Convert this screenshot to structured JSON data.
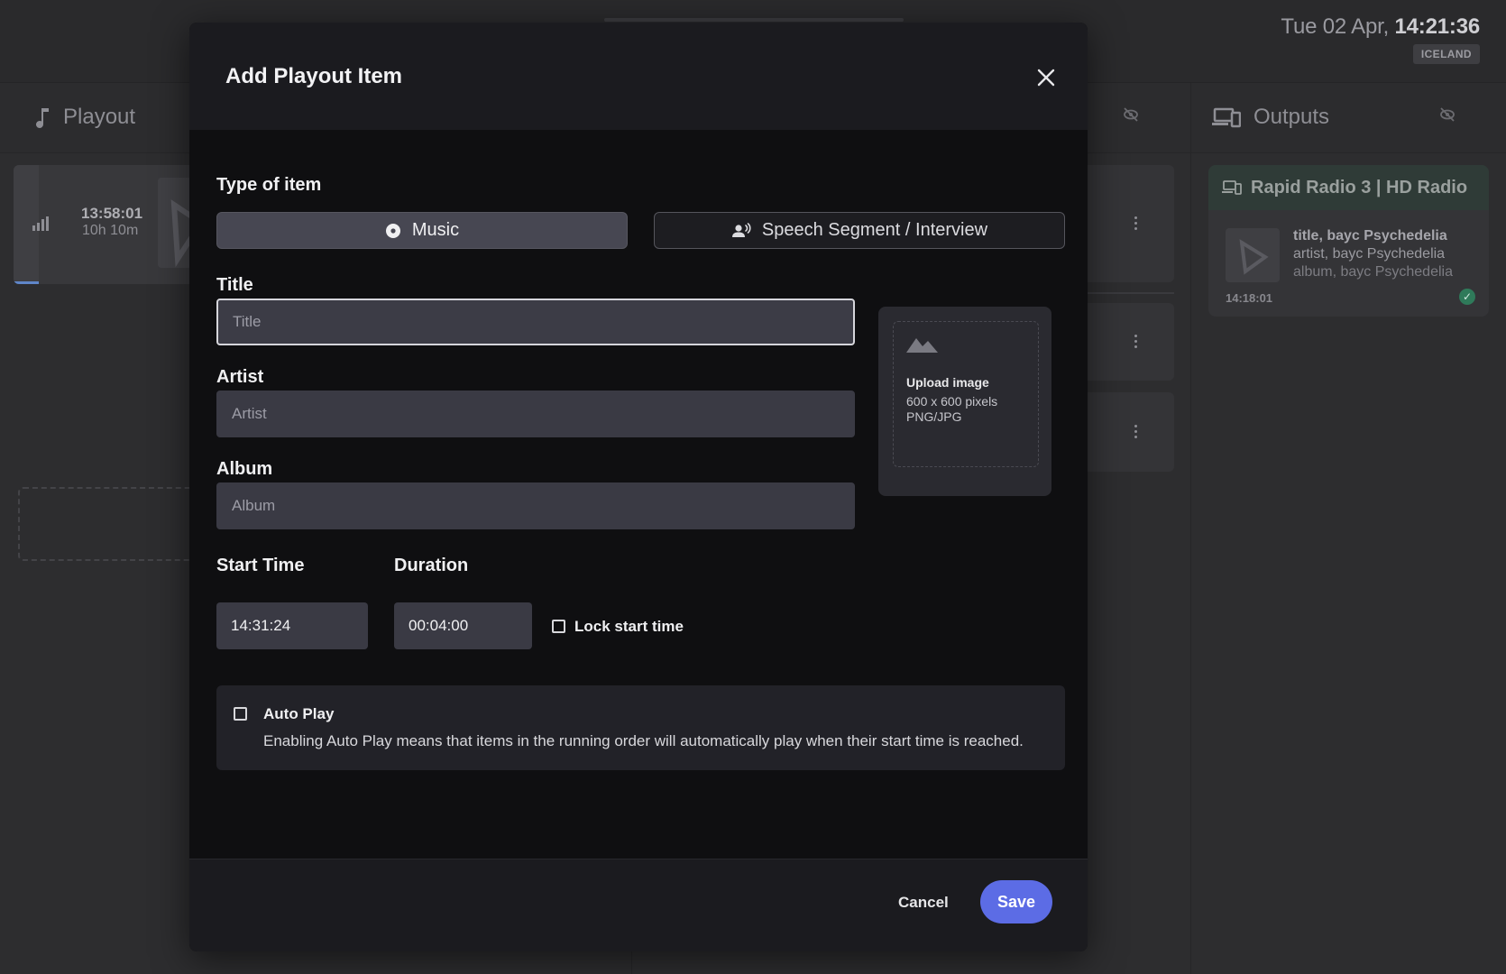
{
  "background": {
    "clock": {
      "date": "Tue 02 Apr,",
      "time": "14:21:36",
      "timezone": "ICELAND"
    },
    "panels": {
      "playout": {
        "title": "Playout",
        "icon": "music-note-icon"
      },
      "outputs": {
        "title": "Outputs",
        "icon": "devices-icon"
      }
    },
    "playout_item": {
      "time": "13:58:01",
      "duration": "10h 10m"
    },
    "output_card": {
      "station": "Rapid Radio 3 | HD Radio",
      "title": "title, bayc Psychedelia",
      "artist": "artist, bayc Psychedelia",
      "album": "album, bayc Psychedelia",
      "time": "14:18:01"
    }
  },
  "modal": {
    "title": "Add Playout Item",
    "type_label": "Type of item",
    "types": [
      {
        "label": "Music",
        "icon": "disc-icon",
        "selected": true
      },
      {
        "label": "Speech Segment / Interview",
        "icon": "speaker-person-icon",
        "selected": false
      }
    ],
    "title_field": {
      "label": "Title",
      "placeholder": "Title",
      "value": ""
    },
    "artist_field": {
      "label": "Artist",
      "placeholder": "Artist",
      "value": ""
    },
    "album_field": {
      "label": "Album",
      "placeholder": "Album",
      "value": ""
    },
    "upload": {
      "title": "Upload image",
      "dimensions": "600 x 600 pixels",
      "formats": "PNG/JPG",
      "icon": "mountain-image-icon"
    },
    "start_time": {
      "label": "Start Time",
      "value": "14:31:24"
    },
    "duration": {
      "label": "Duration",
      "value": "00:04:00"
    },
    "lock_start": {
      "label": "Lock start time",
      "checked": false
    },
    "auto_play": {
      "label": "Auto Play",
      "checked": false,
      "description": "Enabling Auto Play means that items in the running order will automatically play when their start time is reached."
    },
    "footer": {
      "cancel": "Cancel",
      "save": "Save"
    },
    "colors": {
      "accent": "#5c6ce5",
      "selected_type": "#474752"
    }
  }
}
